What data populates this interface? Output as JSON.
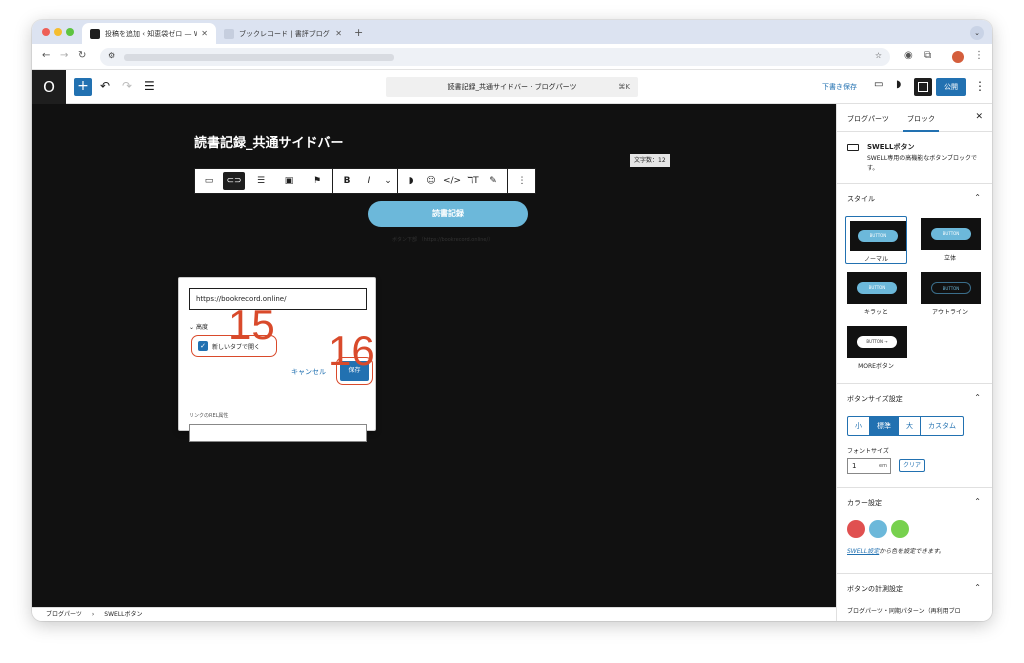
{
  "browser": {
    "tabs": [
      {
        "title": "投稿を追加 ‹ 知恵袋ゼロ — Wor",
        "active": true
      },
      {
        "title": "ブックレコード | 書評ブログ",
        "active": false
      }
    ],
    "new_tab_label": "+",
    "tab_menu_label": "⌄"
  },
  "wp": {
    "logo": "O",
    "doc_title": "読書記録_共通サイドバー · ブログパーツ",
    "doc_shortcut": "⌘K",
    "draft_label": "下書き保存",
    "publish_label": "公開"
  },
  "editor": {
    "post_title": "読書記録_共通サイドバー",
    "word_count": "文字数：12",
    "button_text": "読書記録",
    "faint_text": "ボタン下部 （https://bookrecord.online/）"
  },
  "link_popover": {
    "url_value": "https://bookrecord.online/",
    "advanced_label": "高度",
    "new_tab_label": "新しいタブで開く",
    "new_tab_checked": true,
    "cancel_label": "キャンセル",
    "save_label": "保存",
    "rel_label": "リンクのREL属性",
    "rel_value": "",
    "step_numbers": [
      "15",
      "16"
    ]
  },
  "breadcrumb": [
    "ブログパーツ",
    "›",
    "SWELLボタン"
  ],
  "sidebar": {
    "tabs": [
      "ブログパーツ",
      "ブロック"
    ],
    "active_tab": "ブロック",
    "close_label": "✕",
    "block_name": "SWELLボタン",
    "block_desc": "SWELL専用の高機能なボタンブロックです。",
    "style_title": "スタイル",
    "styles": [
      {
        "label": "ノーマル",
        "pill": "BUTTON",
        "selected": true
      },
      {
        "label": "立体",
        "pill": "BUTTON",
        "selected": false
      },
      {
        "label": "キラッと",
        "pill": "BUTTON",
        "selected": false
      },
      {
        "label": "アウトライン",
        "pill": "BUTTON",
        "selected": false
      },
      {
        "label": "MOREボタン",
        "pill": "BUTTON →",
        "selected": false
      }
    ],
    "size_title": "ボタンサイズ設定",
    "sizes": [
      "小",
      "標準",
      "大",
      "カスタム"
    ],
    "active_size": "標準",
    "font_size_label": "フォントサイズ",
    "font_size_value": "1",
    "font_size_unit": "em",
    "clear_label": "クリア",
    "color_title": "カラー設定",
    "colors": [
      "#e05050",
      "#6cb8da",
      "#77d14e"
    ],
    "color_link": "SWELL設定",
    "color_note": "から色を設定できます。",
    "measure_title": "ボタンの計測設定",
    "measure_sub": "ブログパーツ・同期パターン（再利用ブロ"
  }
}
